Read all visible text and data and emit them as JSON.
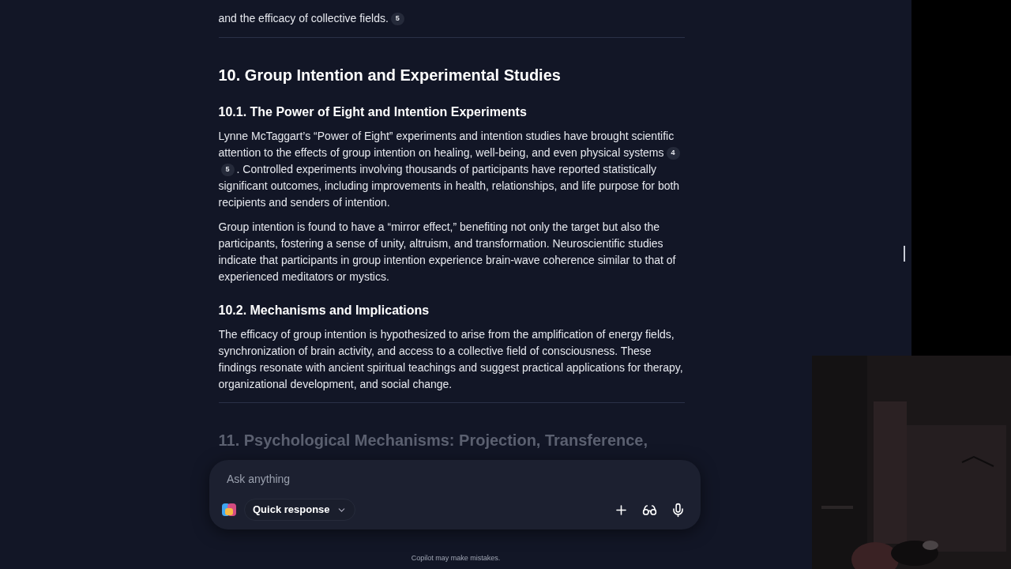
{
  "article": {
    "lead": [
      {
        "kind": "text",
        "text": "and the efficacy of collective fields."
      },
      {
        "kind": "cite",
        "text": "5"
      }
    ],
    "sections": [
      {
        "title": "10. Group Intention and Experimental Studies",
        "subsections": [
          {
            "title": "10.1. The Power of Eight and Intention Experiments",
            "paragraphs": [
              [
                {
                  "kind": "text",
                  "text": "Lynne McTaggart’s “Power of Eight” experiments and intention studies have brought scientific attention to the effects of group intention on healing, well-being, and even physical systems"
                },
                {
                  "kind": "cite",
                  "text": "4"
                },
                {
                  "kind": "cite",
                  "text": "5"
                },
                {
                  "kind": "text",
                  "text": ". Controlled experiments involving thousands of participants have reported statistically significant outcomes, including improvements in health, relationships, and life purpose for both recipients and senders of intention."
                }
              ],
              [
                {
                  "kind": "text",
                  "text": "Group intention is found to have a “mirror effect,” benefiting not only the target but also the participants, fostering a sense of unity, altruism, and transformation. Neuroscientific studies indicate that participants in group intention experience brain-wave coherence similar to that of experienced meditators or mystics."
                }
              ]
            ]
          },
          {
            "title": "10.2. Mechanisms and Implications",
            "paragraphs": [
              [
                {
                  "kind": "text",
                  "text": "The efficacy of group intention is hypothesized to arise from the amplification of energy fields, synchronization of brain activity, and access to a collective field of consciousness. These findings resonate with ancient spiritual teachings and suggest practical applications for therapy, organizational development, and social change."
                }
              ]
            ]
          }
        ]
      }
    ],
    "next_heading": "11. Psychological Mechanisms: Projection, Transference,"
  },
  "composer": {
    "placeholder": "Ask anything",
    "mode": "Quick response"
  },
  "disclaimer": "Copilot may make mistakes."
}
